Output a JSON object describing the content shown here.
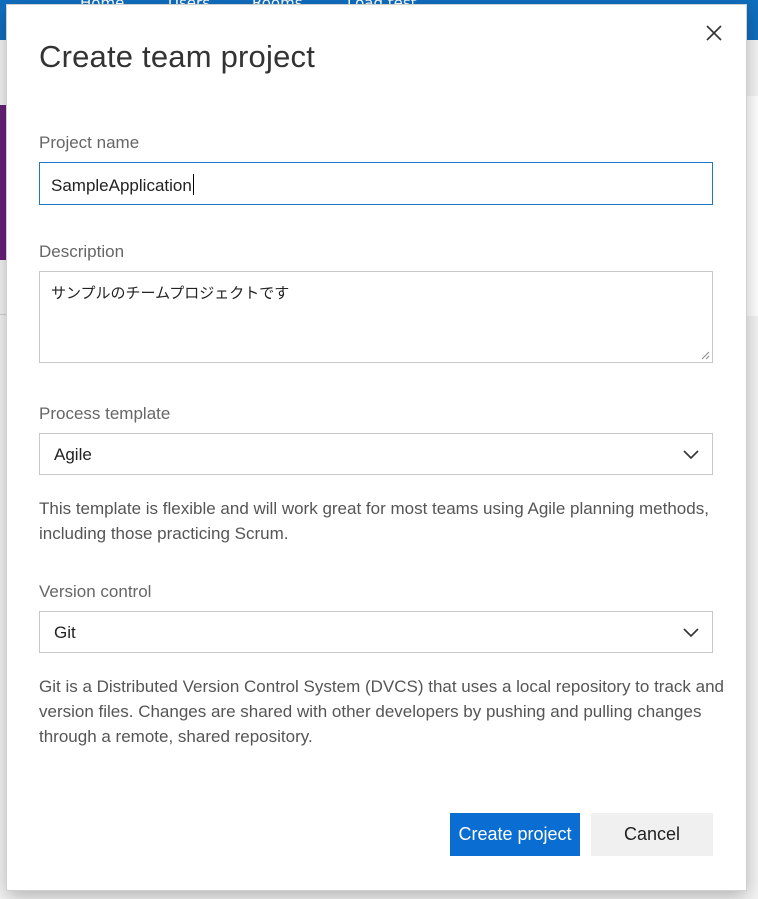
{
  "background": {
    "nav": [
      "Home",
      "Users",
      "Rooms",
      "Load test"
    ]
  },
  "dialog": {
    "title": "Create team project",
    "project_name": {
      "label": "Project name",
      "value": "SampleApplication"
    },
    "description": {
      "label": "Description",
      "value": "サンプルのチームプロジェクトです"
    },
    "process_template": {
      "label": "Process template",
      "selected": "Agile",
      "help": "This template is flexible and will work great for most teams using Agile planning methods, including those practicing Scrum."
    },
    "version_control": {
      "label": "Version control",
      "selected": "Git",
      "help": "Git is a Distributed Version Control System (DVCS) that uses a local repository to track and version files. Changes are shared with other developers by pushing and pulling changes through a remote, shared repository."
    },
    "buttons": {
      "create": "Create project",
      "cancel": "Cancel"
    }
  },
  "icons": {
    "close": "close-icon",
    "dropdown": "chevron-down-icon"
  },
  "colors": {
    "topbar": "#106ebe",
    "primary_button": "#0a6dd1",
    "focus_border": "#1e77c6"
  }
}
